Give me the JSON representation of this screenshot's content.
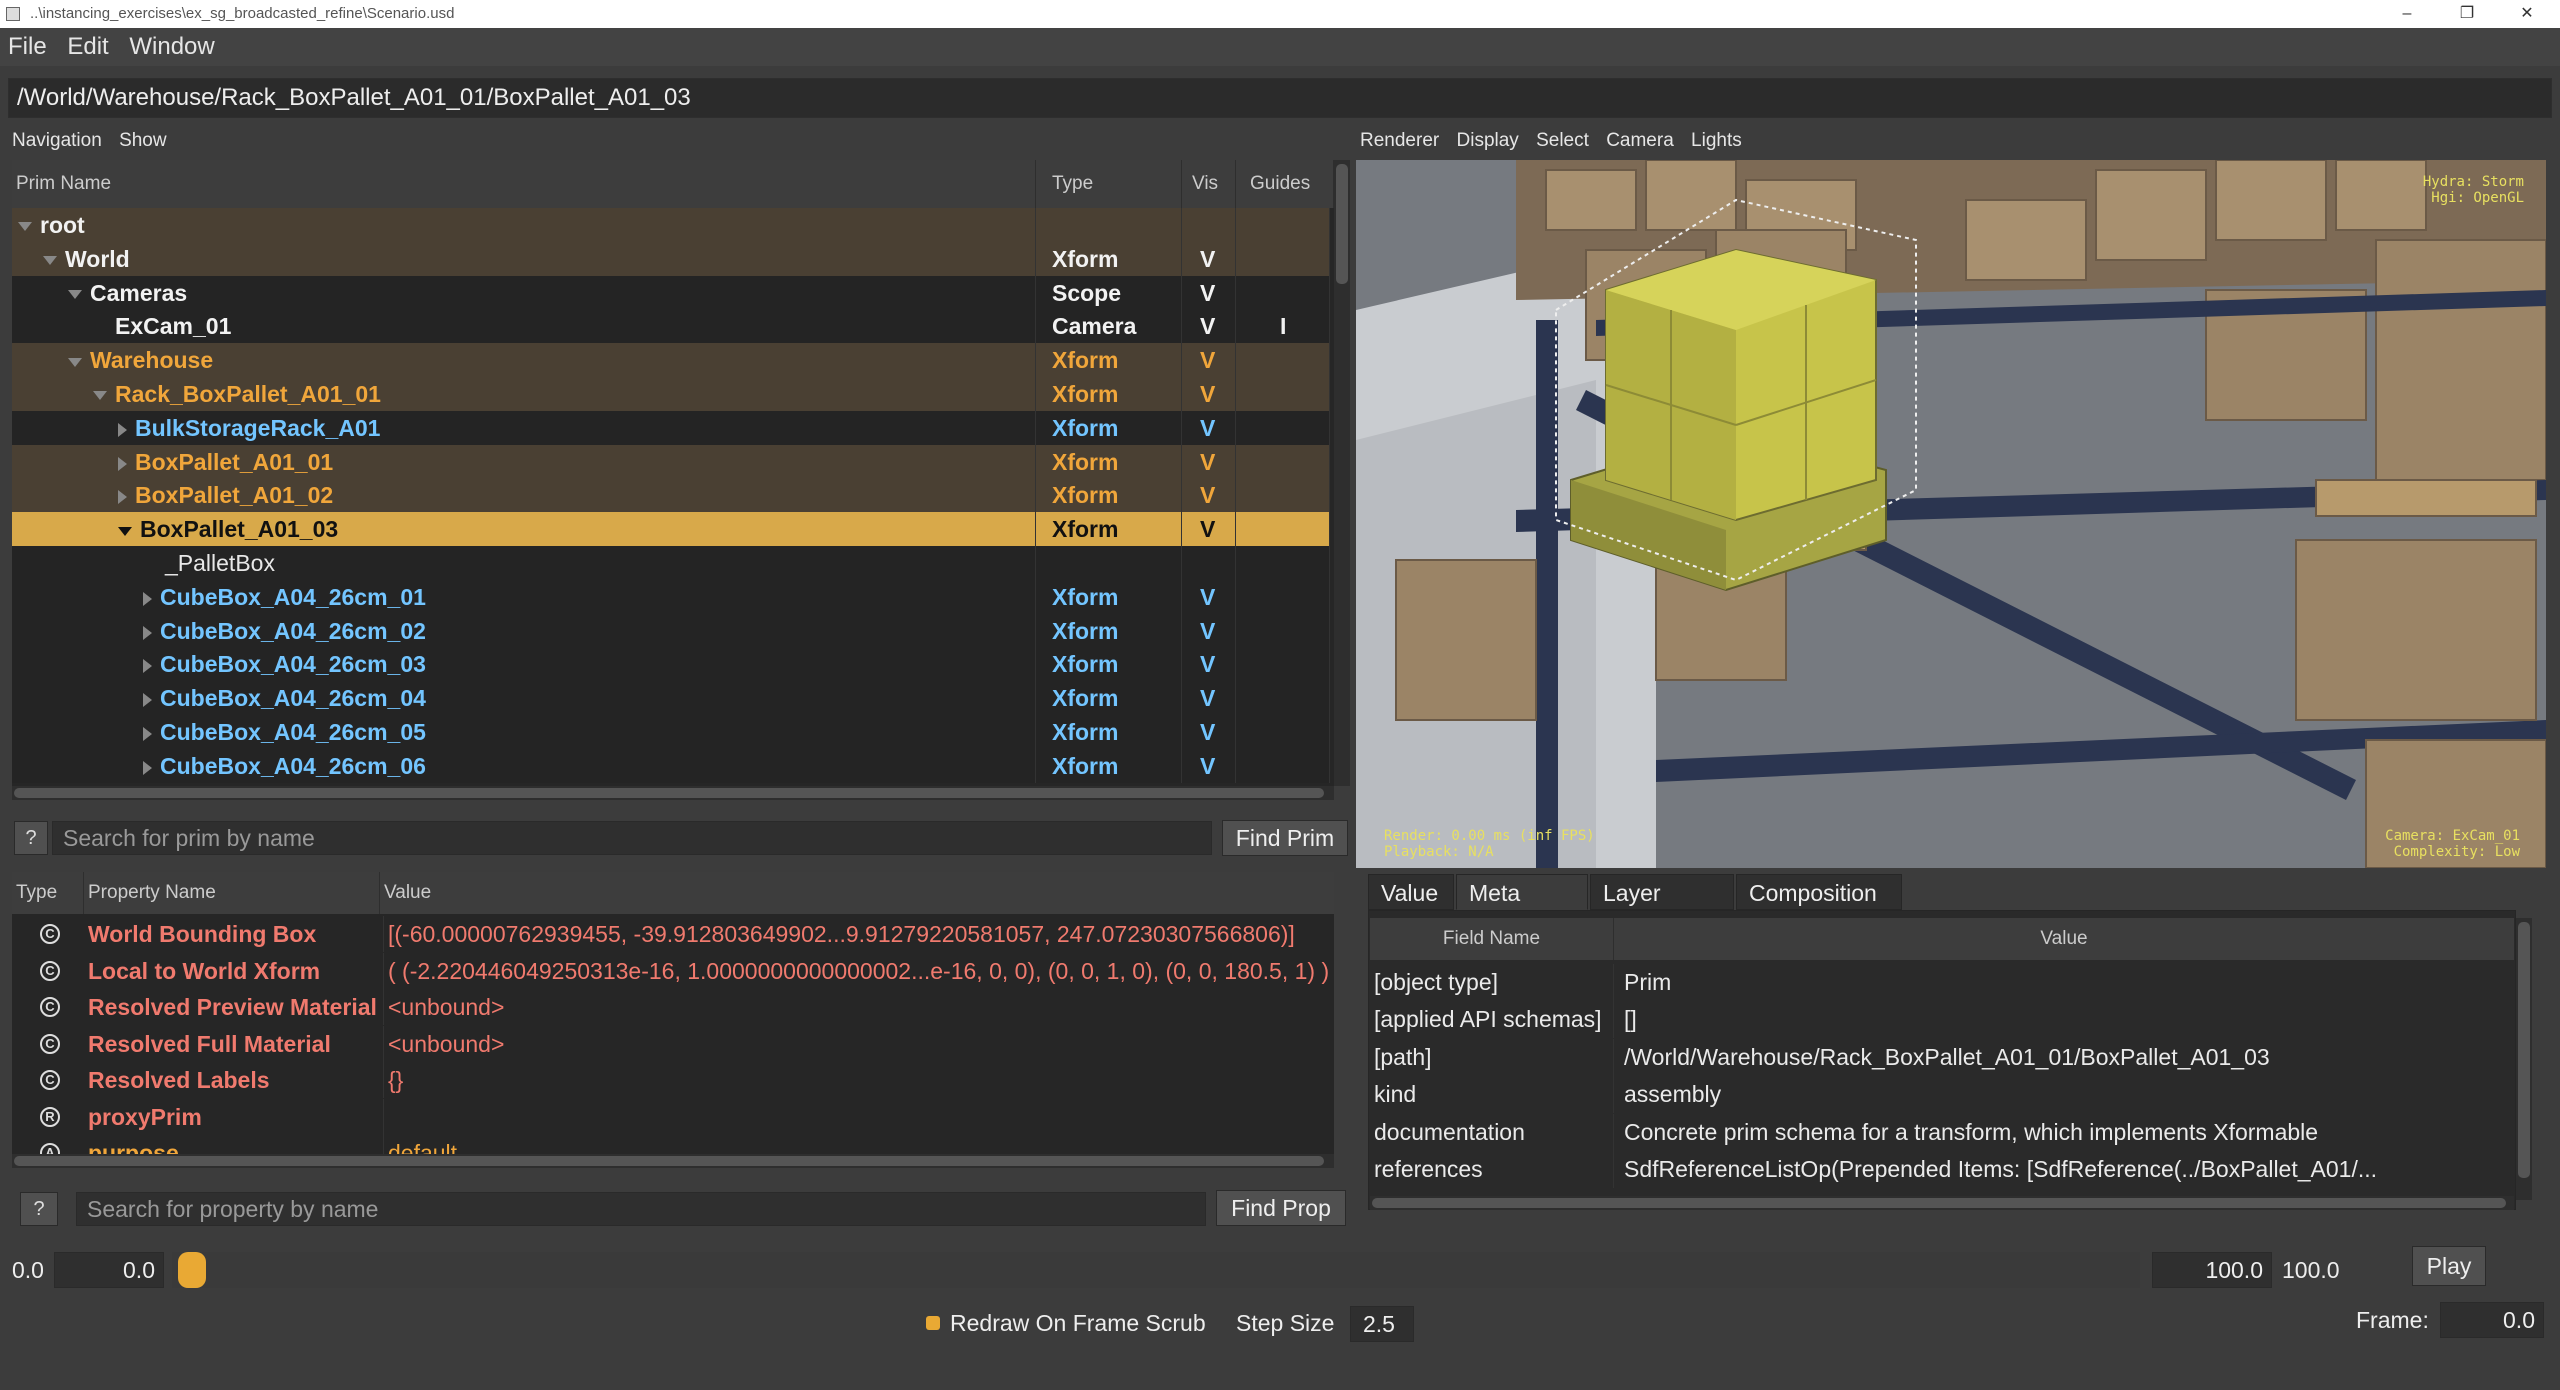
{
  "window": {
    "title": "..\\instancing_exercises\\ex_sg_broadcasted_refine\\Scenario.usd"
  },
  "menu": [
    "File",
    "Edit",
    "Window"
  ],
  "current_path": "/World/Warehouse/Rack_BoxPallet_A01_01/BoxPallet_A01_03",
  "tree_panel": {
    "menu": [
      "Navigation",
      "Show"
    ],
    "columns": {
      "name": "Prim Name",
      "type": "Type",
      "vis": "Vis",
      "guides": "Guides"
    },
    "rows": [
      {
        "name": "root",
        "type": "",
        "vis": "",
        "guides": "",
        "depth": 0,
        "expander": "open",
        "style": "root"
      },
      {
        "name": "World",
        "type": "Xform",
        "vis": "V",
        "guides": "",
        "depth": 1,
        "expander": "open",
        "style": "white"
      },
      {
        "name": "Cameras",
        "type": "Scope",
        "vis": "V",
        "guides": "",
        "depth": 2,
        "expander": "open",
        "style": "white"
      },
      {
        "name": "ExCam_01",
        "type": "Camera",
        "vis": "V",
        "guides": "I",
        "depth": 3,
        "expander": "none",
        "style": "white"
      },
      {
        "name": "Warehouse",
        "type": "Xform",
        "vis": "V",
        "guides": "",
        "depth": 2,
        "expander": "open",
        "style": "orange"
      },
      {
        "name": "Rack_BoxPallet_A01_01",
        "type": "Xform",
        "vis": "V",
        "guides": "",
        "depth": 3,
        "expander": "open",
        "style": "orange"
      },
      {
        "name": "BulkStorageRack_A01",
        "type": "Xform",
        "vis": "V",
        "guides": "",
        "depth": 4,
        "expander": "closed",
        "style": "blue"
      },
      {
        "name": "BoxPallet_A01_01",
        "type": "Xform",
        "vis": "V",
        "guides": "",
        "depth": 4,
        "expander": "closed",
        "style": "orange"
      },
      {
        "name": "BoxPallet_A01_02",
        "type": "Xform",
        "vis": "V",
        "guides": "",
        "depth": 4,
        "expander": "closed",
        "style": "orange"
      },
      {
        "name": "BoxPallet_A01_03",
        "type": "Xform",
        "vis": "V",
        "guides": "",
        "depth": 4,
        "expander": "open",
        "style": "selected"
      },
      {
        "name": "_PalletBox",
        "type": "",
        "vis": "",
        "guides": "",
        "depth": 5,
        "expander": "none",
        "style": "plain"
      },
      {
        "name": "CubeBox_A04_26cm_01",
        "type": "Xform",
        "vis": "V",
        "guides": "",
        "depth": 5,
        "expander": "closed",
        "style": "blue"
      },
      {
        "name": "CubeBox_A04_26cm_02",
        "type": "Xform",
        "vis": "V",
        "guides": "",
        "depth": 5,
        "expander": "closed",
        "style": "blue"
      },
      {
        "name": "CubeBox_A04_26cm_03",
        "type": "Xform",
        "vis": "V",
        "guides": "",
        "depth": 5,
        "expander": "closed",
        "style": "blue"
      },
      {
        "name": "CubeBox_A04_26cm_04",
        "type": "Xform",
        "vis": "V",
        "guides": "",
        "depth": 5,
        "expander": "closed",
        "style": "blue"
      },
      {
        "name": "CubeBox_A04_26cm_05",
        "type": "Xform",
        "vis": "V",
        "guides": "",
        "depth": 5,
        "expander": "closed",
        "style": "blue"
      },
      {
        "name": "CubeBox_A04_26cm_06",
        "type": "Xform",
        "vis": "V",
        "guides": "",
        "depth": 5,
        "expander": "closed",
        "style": "blue"
      }
    ],
    "search": {
      "help": "?",
      "placeholder": "Search for prim by name",
      "button": "Find Prim"
    }
  },
  "property_panel": {
    "columns": {
      "type": "Type",
      "name": "Property Name",
      "value": "Value"
    },
    "rows": [
      {
        "icon": "C",
        "name": "World Bounding Box",
        "value": "[(-60.00000762939455, -39.912803649902...9.91279220581057, 247.07230307566806)]",
        "style": "red"
      },
      {
        "icon": "C",
        "name": "Local to World Xform",
        "value": "( (-2.220446049250313e-16, 1.0000000000000002...e-16, 0, 0), (0, 0, 1, 0), (0, 0, 180.5, 1) )",
        "style": "red"
      },
      {
        "icon": "C",
        "name": "Resolved Preview Material",
        "value": "<unbound>",
        "style": "red"
      },
      {
        "icon": "C",
        "name": "Resolved Full Material",
        "value": "<unbound>",
        "style": "red"
      },
      {
        "icon": "C",
        "name": "Resolved Labels",
        "value": "{}",
        "style": "red"
      },
      {
        "icon": "R",
        "name": "proxyPrim",
        "value": "",
        "style": "red"
      },
      {
        "icon": "A",
        "name": "purpose",
        "value": "default",
        "style": "orange"
      }
    ],
    "search": {
      "help": "?",
      "placeholder": "Search for property by name",
      "button": "Find Prop"
    }
  },
  "viewport": {
    "menu": [
      "Renderer",
      "Display",
      "Select",
      "Camera",
      "Lights"
    ],
    "hud_top_right": [
      "Hydra: Storm",
      "Hgi: OpenGL"
    ],
    "hud_bottom_left": [
      "Render: 0.00 ms (inf FPS)",
      "Playback: N/A"
    ],
    "hud_bottom_right": [
      "Camera: ExCam_01",
      "Complexity: Low"
    ]
  },
  "metadata_panel": {
    "tabs": [
      "Value",
      "Meta Data",
      "Layer Stack",
      "Composition"
    ],
    "active_tab": "Meta Data",
    "columns": {
      "field": "Field Name",
      "value": "Value"
    },
    "rows": [
      {
        "field": "[object type]",
        "value": "Prim"
      },
      {
        "field": "[applied API schemas]",
        "value": "[]"
      },
      {
        "field": "[path]",
        "value": "/World/Warehouse/Rack_BoxPallet_A01_01/BoxPallet_A01_03"
      },
      {
        "field": "kind",
        "value": "assembly"
      },
      {
        "field": "documentation",
        "value": "Concrete prim schema for a transform, which implements Xformable"
      },
      {
        "field": "references",
        "value": "SdfReferenceListOp(Prepended Items: [SdfReference(../BoxPallet_A01/..."
      }
    ]
  },
  "timeline": {
    "start_label": "0.0",
    "start_value": "0.0",
    "end_value": "100.0",
    "end_label": "100.0",
    "play_button": "Play",
    "redraw_label": "Redraw On Frame Scrub",
    "step_size_label": "Step Size",
    "step_size_value": "2.5",
    "frame_label": "Frame:",
    "frame_value": "0.0"
  },
  "colors": {
    "accent_orange": "#f0a63b",
    "prim_blue": "#73c5ff",
    "property_red": "#f07a6e",
    "selection": "#d8a94a",
    "highlight_yellow": "#c9c64a"
  }
}
